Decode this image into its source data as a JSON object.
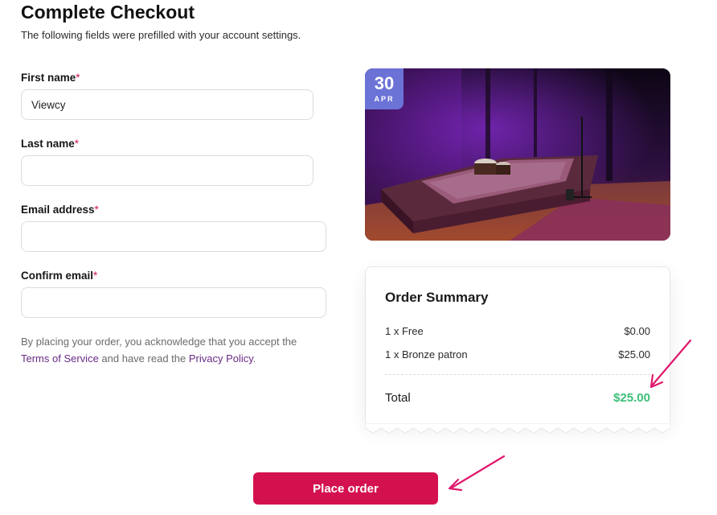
{
  "header": {
    "title": "Complete Checkout",
    "subtitle": "The following fields were prefilled with your account settings."
  },
  "form": {
    "required_marker": "*",
    "fields": [
      {
        "label": "First name",
        "value": "Viewcy",
        "placeholder": ""
      },
      {
        "label": "Last name",
        "value": "",
        "placeholder": ""
      },
      {
        "label": "Email address",
        "value": "",
        "placeholder": ""
      },
      {
        "label": "Confirm email",
        "value": "",
        "placeholder": ""
      }
    ]
  },
  "legal": {
    "prefix": "By placing your order, you acknowledge that you accept the ",
    "terms_link": "Terms of Service",
    "middle": " and have read the ",
    "privacy_link": "Privacy Policy",
    "suffix": "."
  },
  "event": {
    "date_day": "30",
    "date_month": "APR"
  },
  "summary": {
    "title": "Order Summary",
    "items": [
      {
        "label": "1 x Free",
        "price": "$0.00"
      },
      {
        "label": "1 x Bronze patron",
        "price": "$25.00"
      }
    ],
    "total_label": "Total",
    "total_amount": "$25.00"
  },
  "actions": {
    "place_order_label": "Place order"
  },
  "colors": {
    "accent": "#d4114f",
    "total_green": "#3cbf77",
    "link_purple": "#6a2a86",
    "date_badge": "#6b73d6",
    "annotation_arrow": "#e0186c"
  }
}
